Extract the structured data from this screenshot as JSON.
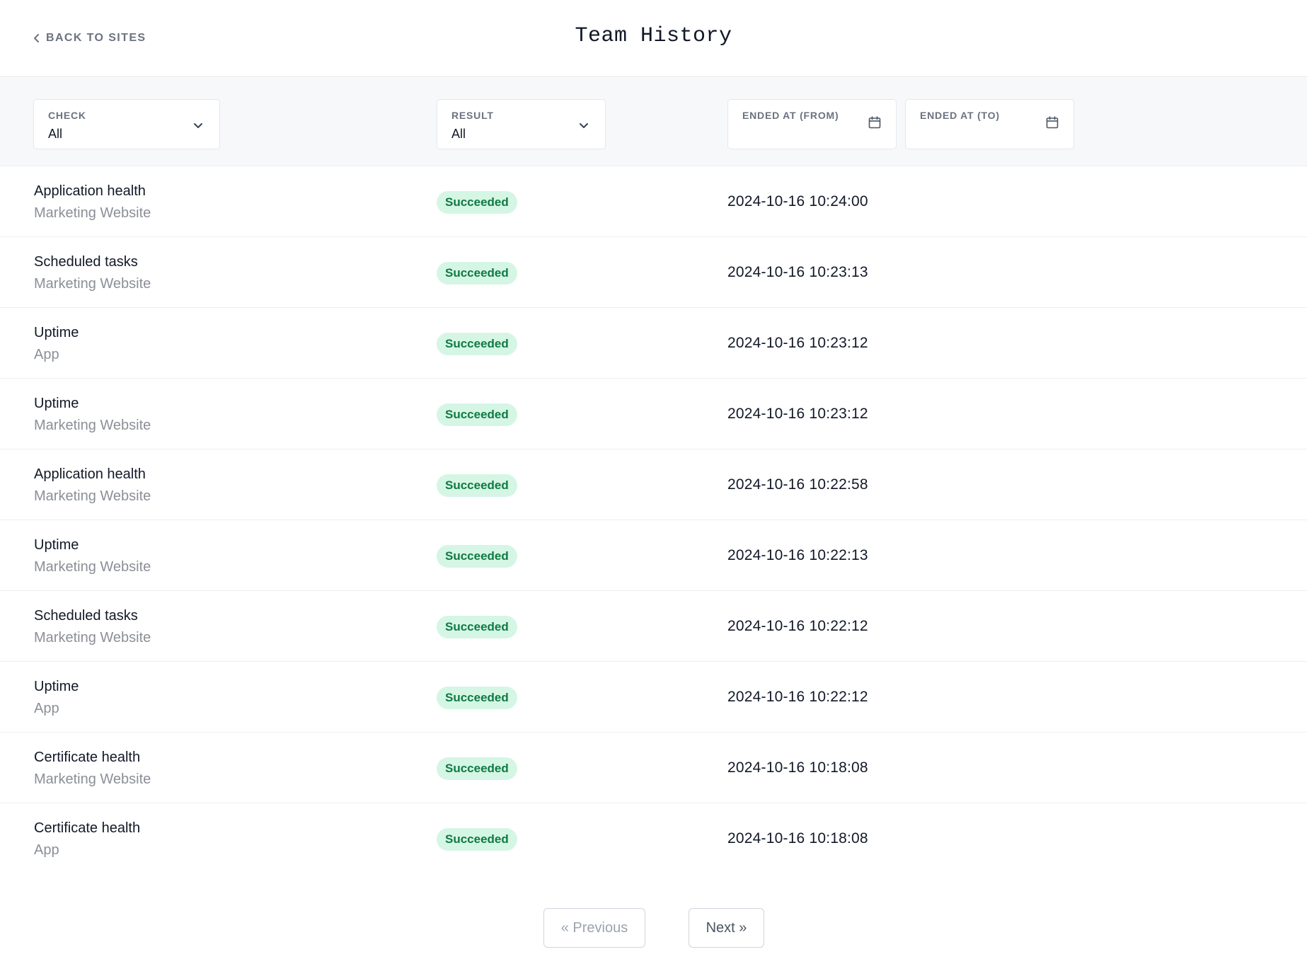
{
  "header": {
    "back_label": "BACK TO SITES",
    "title": "Team History"
  },
  "filters": {
    "check": {
      "label": "CHECK",
      "value": "All"
    },
    "result": {
      "label": "RESULT",
      "value": "All"
    },
    "ended_from": {
      "label": "ENDED AT (FROM)",
      "value": ""
    },
    "ended_to": {
      "label": "ENDED AT (TO)",
      "value": ""
    }
  },
  "rows": [
    {
      "check": "Application health",
      "site": "Marketing Website",
      "result": "Succeeded",
      "ended_at": "2024-10-16 10:24:00"
    },
    {
      "check": "Scheduled tasks",
      "site": "Marketing Website",
      "result": "Succeeded",
      "ended_at": "2024-10-16 10:23:13"
    },
    {
      "check": "Uptime",
      "site": "App",
      "result": "Succeeded",
      "ended_at": "2024-10-16 10:23:12"
    },
    {
      "check": "Uptime",
      "site": "Marketing Website",
      "result": "Succeeded",
      "ended_at": "2024-10-16 10:23:12"
    },
    {
      "check": "Application health",
      "site": "Marketing Website",
      "result": "Succeeded",
      "ended_at": "2024-10-16 10:22:58"
    },
    {
      "check": "Uptime",
      "site": "Marketing Website",
      "result": "Succeeded",
      "ended_at": "2024-10-16 10:22:13"
    },
    {
      "check": "Scheduled tasks",
      "site": "Marketing Website",
      "result": "Succeeded",
      "ended_at": "2024-10-16 10:22:12"
    },
    {
      "check": "Uptime",
      "site": "App",
      "result": "Succeeded",
      "ended_at": "2024-10-16 10:22:12"
    },
    {
      "check": "Certificate health",
      "site": "Marketing Website",
      "result": "Succeeded",
      "ended_at": "2024-10-16 10:18:08"
    },
    {
      "check": "Certificate health",
      "site": "App",
      "result": "Succeeded",
      "ended_at": "2024-10-16 10:18:08"
    }
  ],
  "pagination": {
    "previous_label": "« Previous",
    "next_label": "Next »"
  },
  "colors": {
    "success_badge_bg": "#d5f6e5",
    "success_badge_text": "#0f7a43",
    "filter_bar_bg": "#f7f8fa"
  },
  "icons": {
    "back": "chevron-left-icon",
    "dropdown": "chevron-down-icon",
    "date": "calendar-icon"
  }
}
